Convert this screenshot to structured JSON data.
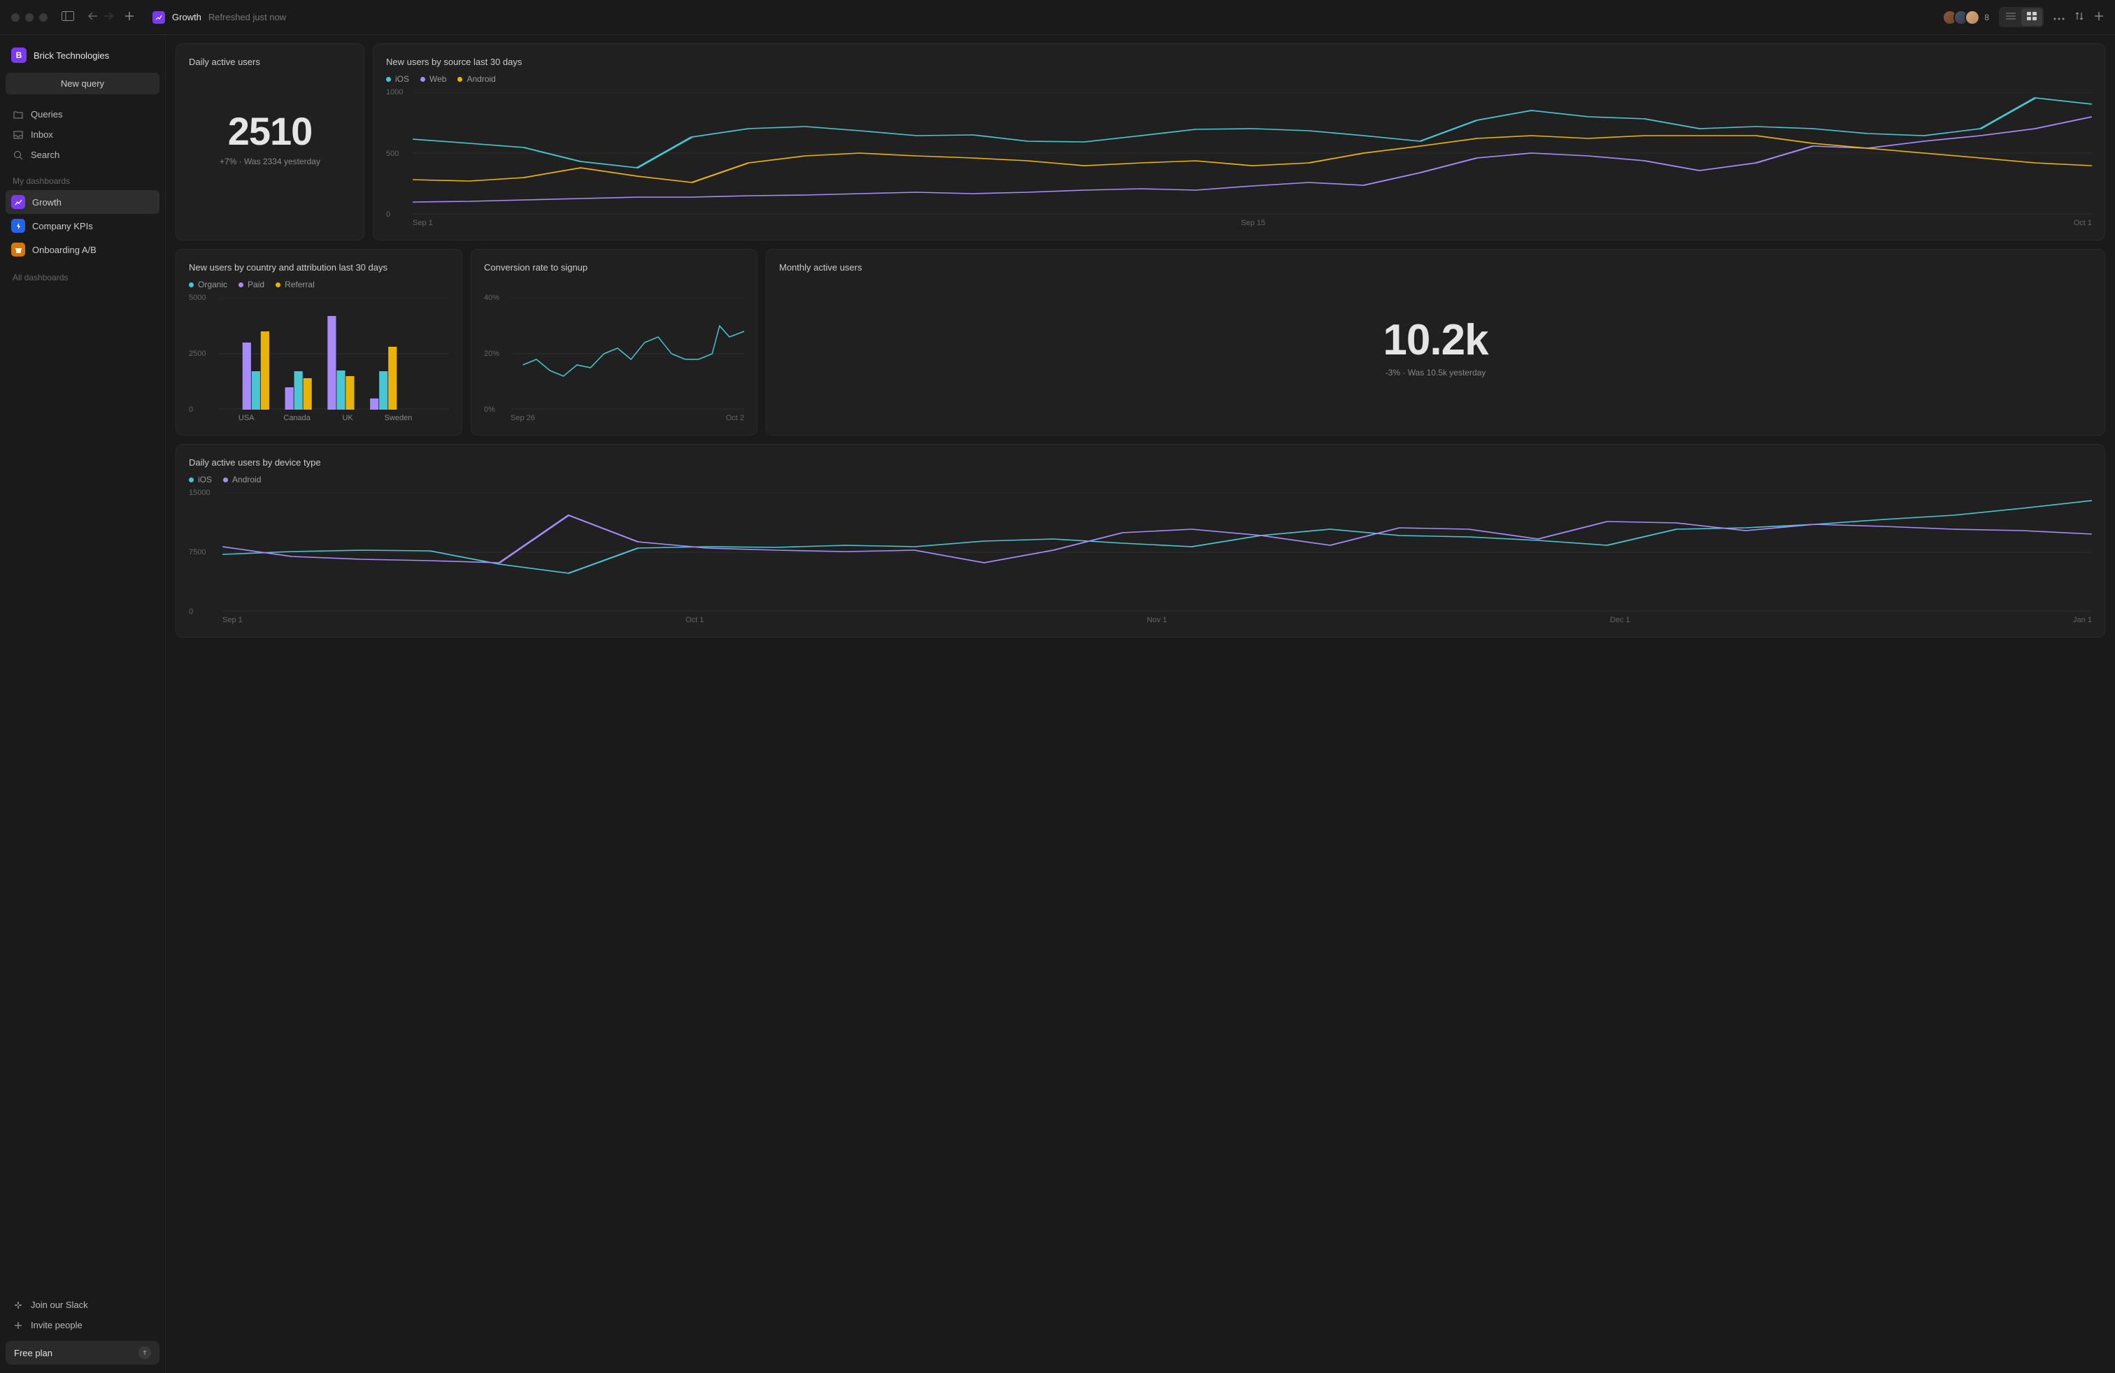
{
  "header": {
    "title": "Growth",
    "subtitle": "Refreshed just now",
    "avatar_count": "8"
  },
  "workspace": {
    "initial": "B",
    "name": "Brick Technologies"
  },
  "sidebar": {
    "new_query": "New query",
    "nav": {
      "queries": "Queries",
      "inbox": "Inbox",
      "search": "Search"
    },
    "section_my": "My dashboards",
    "section_all": "All dashboards",
    "dashboards": {
      "growth": "Growth",
      "company_kpis": "Company KPIs",
      "onboarding": "Onboarding A/B"
    },
    "join_slack": "Join our Slack",
    "invite": "Invite people",
    "plan": "Free plan"
  },
  "cards": {
    "daily_active": {
      "title": "Daily active users",
      "value": "2510",
      "sub": "+7% · Was 2334 yesterday"
    },
    "new_by_source": {
      "title": "New users by source last 30 days",
      "legend": {
        "ios": "iOS",
        "web": "Web",
        "android": "Android"
      },
      "y": {
        "top": "1000",
        "mid": "500",
        "bot": "0"
      },
      "x": {
        "a": "Sep 1",
        "b": "Sep 15",
        "c": "Oct 1"
      }
    },
    "by_country": {
      "title": "New users by country and attribution last 30 days",
      "legend": {
        "organic": "Organic",
        "paid": "Paid",
        "referral": "Referral"
      },
      "y": {
        "top": "5000",
        "mid": "2500",
        "bot": "0"
      },
      "x": {
        "a": "USA",
        "b": "Canada",
        "c": "UK",
        "d": "Sweden"
      }
    },
    "conversion": {
      "title": "Conversion rate to signup",
      "y": {
        "top": "40%",
        "mid": "20%",
        "bot": "0%"
      },
      "x": {
        "a": "Sep 26",
        "b": "Oct 2"
      }
    },
    "monthly_active": {
      "title": "Monthly active users",
      "value": "10.2k",
      "sub": "-3% · Was 10.5k yesterday"
    },
    "by_device": {
      "title": "Daily active users by device type",
      "legend": {
        "ios": "iOS",
        "android": "Android"
      },
      "y": {
        "top": "15000",
        "mid": "7500",
        "bot": "0"
      },
      "x": {
        "a": "Sep 1",
        "b": "Oct 1",
        "c": "Nov 1",
        "d": "Dec 1",
        "e": "Jan 1"
      }
    }
  },
  "colors": {
    "ios": "#4ac6d2",
    "web": "#a78bfa",
    "android_line": "#eab308",
    "organic": "#4ac6d2",
    "paid": "#a78bfa",
    "referral": "#eab308",
    "android_bar": "#a78bfa"
  },
  "chart_data": [
    {
      "id": "new_by_source",
      "type": "line",
      "title": "New users by source last 30 days",
      "xlabel": "",
      "ylabel": "",
      "ylim": [
        0,
        1000
      ],
      "x_ticks": [
        "Sep 1",
        "Sep 15",
        "Oct 1"
      ],
      "series": [
        {
          "name": "iOS",
          "values": [
            620,
            580,
            540,
            430,
            380,
            630,
            700,
            720,
            680,
            640,
            650,
            600,
            590,
            640,
            690,
            700,
            680,
            640,
            600,
            770,
            850,
            800,
            780,
            700,
            720,
            700,
            660,
            640,
            700,
            950,
            900
          ]
        },
        {
          "name": "Web",
          "values": [
            100,
            110,
            120,
            130,
            140,
            140,
            150,
            160,
            170,
            180,
            170,
            180,
            200,
            210,
            200,
            230,
            260,
            240,
            340,
            460,
            500,
            480,
            440,
            360,
            420,
            560,
            540,
            600,
            640,
            700,
            800
          ]
        },
        {
          "name": "Android",
          "values": [
            280,
            270,
            300,
            380,
            310,
            260,
            420,
            480,
            500,
            480,
            460,
            440,
            400,
            420,
            440,
            400,
            420,
            500,
            560,
            620,
            640,
            620,
            640,
            640,
            640,
            580,
            540,
            500,
            460,
            420,
            400
          ]
        }
      ]
    },
    {
      "id": "by_country",
      "type": "bar",
      "title": "New users by country and attribution last 30 days",
      "ylim": [
        0,
        5000
      ],
      "categories": [
        "USA",
        "Canada",
        "UK",
        "Sweden"
      ],
      "series": [
        {
          "name": "Organic",
          "values": [
            1700,
            1700,
            1750,
            1700
          ]
        },
        {
          "name": "Paid",
          "values": [
            3000,
            1000,
            4200,
            500
          ]
        },
        {
          "name": "Referral",
          "values": [
            3500,
            1400,
            1500,
            2800
          ]
        }
      ]
    },
    {
      "id": "conversion",
      "type": "line",
      "title": "Conversion rate to signup",
      "ylim": [
        0,
        40
      ],
      "x_ticks": [
        "Sep 26",
        "Oct 2"
      ],
      "series": [
        {
          "name": "rate",
          "values": [
            16,
            18,
            14,
            12,
            16,
            15,
            20,
            22,
            18,
            24,
            26,
            20,
            18,
            18,
            20,
            30,
            26,
            28
          ]
        }
      ]
    },
    {
      "id": "by_device",
      "type": "line",
      "title": "Daily active users by device type",
      "ylim": [
        0,
        15000
      ],
      "x_ticks": [
        "Sep 1",
        "Oct 1",
        "Nov 1",
        "Dec 1",
        "Jan 1"
      ],
      "series": [
        {
          "name": "iOS",
          "values": [
            7200,
            7600,
            7800,
            7700,
            6000,
            4800,
            8000,
            8200,
            8100,
            8400,
            8200,
            8900,
            9200,
            8600,
            8200,
            9600,
            10400,
            9600,
            9400,
            9000,
            8400,
            10400,
            10600,
            11000,
            11600,
            12200,
            13000,
            14000
          ]
        },
        {
          "name": "Android",
          "values": [
            8200,
            7000,
            6600,
            6400,
            6200,
            12200,
            8800,
            8000,
            7800,
            7600,
            7800,
            6200,
            7800,
            10000,
            10400,
            9600,
            8400,
            10600,
            10400,
            9200,
            11400,
            11200,
            10200,
            11000,
            10800,
            10400,
            10200,
            9800
          ]
        }
      ]
    }
  ]
}
